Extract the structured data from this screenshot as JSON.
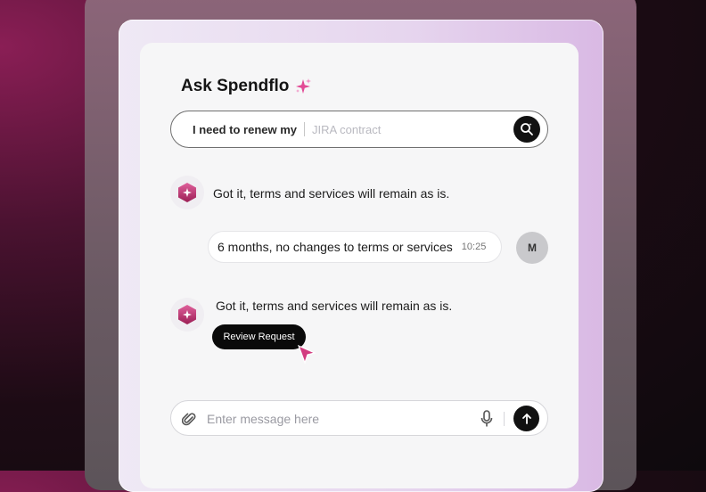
{
  "header": {
    "title": "Ask Spendflo"
  },
  "search": {
    "prefix": "I need to renew my",
    "placeholder": "JIRA contract"
  },
  "messages": [
    {
      "sender": "bot",
      "text": "Got it, terms and services will remain as is."
    },
    {
      "sender": "user",
      "text": "6 months, no changes to terms or services",
      "time": "10:25",
      "avatar_initial": "M"
    },
    {
      "sender": "bot",
      "text": "Got it, terms and services will remain as is.",
      "action_label": "Review Request"
    }
  ],
  "composer": {
    "placeholder": "Enter message here"
  },
  "colors": {
    "accent_pink": "#c2306f",
    "dark": "#111111",
    "panel": "#f6f6f7"
  },
  "icons": [
    "sparkle-icon",
    "search-icon",
    "bot-logo-icon",
    "cursor-icon",
    "paperclip-icon",
    "microphone-icon",
    "arrow-up-icon"
  ]
}
